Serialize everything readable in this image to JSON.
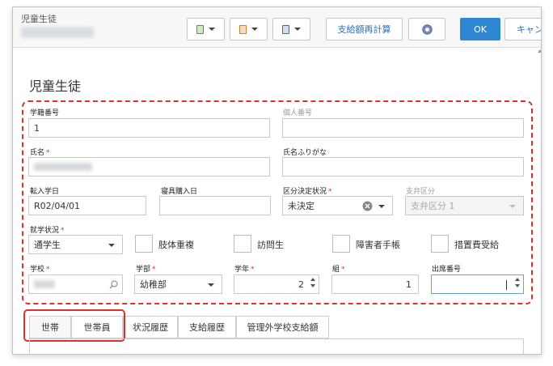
{
  "header": {
    "title": "児童生徒",
    "toolbar": {
      "recalc_label": "支給額再計算",
      "ok_label": "OK",
      "cancel_label": "キャン"
    }
  },
  "page_title": "児童生徒",
  "form": {
    "student_no": {
      "label": "学籍番号",
      "value": "1"
    },
    "personal_no": {
      "label": "個人番号",
      "value": ""
    },
    "name": {
      "label": "氏名",
      "required": "*"
    },
    "name_kana": {
      "label": "氏名ふりがな",
      "value": ""
    },
    "transfer_date": {
      "label": "転入学日",
      "value": "R02/04/01"
    },
    "bedding_date": {
      "label": "寝具購入日",
      "value": ""
    },
    "category_status": {
      "label": "区分決定状況",
      "required": "*",
      "value": "未決定"
    },
    "support_category": {
      "label": "支弁区分",
      "value": "支弁区分 1"
    },
    "enrollment": {
      "label": "就学状況",
      "required": "*",
      "value": "通学生"
    },
    "checkboxes": [
      "肢体重複",
      "訪問生",
      "障害者手帳",
      "措置費受給"
    ],
    "school": {
      "label": "学校",
      "required": "*"
    },
    "department": {
      "label": "学部",
      "required": "*",
      "value": "幼稚部"
    },
    "grade": {
      "label": "学年",
      "required": "*",
      "value": "2"
    },
    "class": {
      "label": "組",
      "required": "*",
      "value": "1"
    },
    "attendance_no": {
      "label": "出席番号",
      "value": ""
    }
  },
  "tabs": [
    "世帯",
    "世帯員",
    "状況履歴",
    "支給履歴",
    "管理外学校支給額"
  ]
}
